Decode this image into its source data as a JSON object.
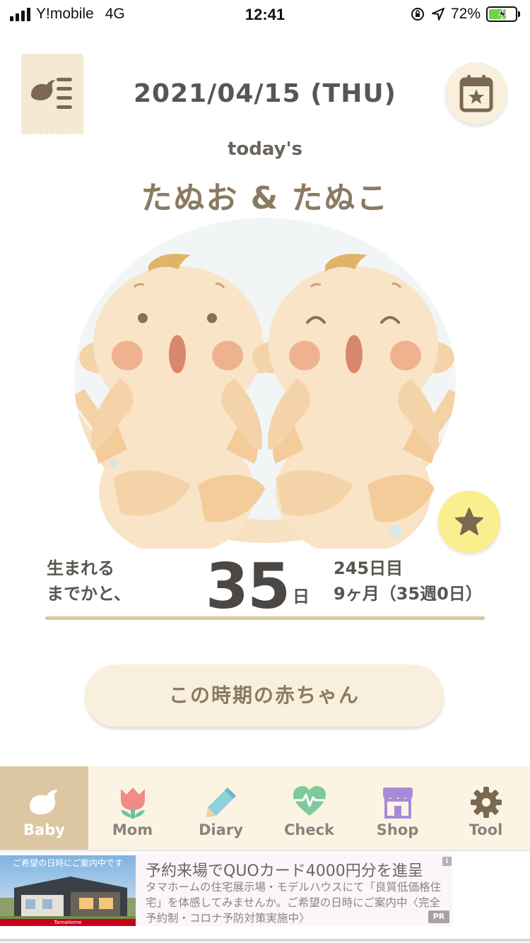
{
  "status_bar": {
    "carrier": "Y!mobile",
    "network": "4G",
    "time": "12:41",
    "battery": "72%"
  },
  "header": {
    "date": "2021/04/15 (THU)",
    "todays": "today's",
    "names": "たぬお & たぬこ"
  },
  "count": {
    "label_line1": "生まれる",
    "label_line2": "までかと、",
    "value": "35",
    "unit": "日",
    "day_number": "245日目",
    "month_week": "9ヶ月（35週0日）"
  },
  "baby_button_label": "この時期の赤ちゃん",
  "tabs": [
    {
      "label": "Baby",
      "icon": "bird-icon"
    },
    {
      "label": "Mom",
      "icon": "tulip-icon"
    },
    {
      "label": "Diary",
      "icon": "pencil-icon"
    },
    {
      "label": "Check",
      "icon": "heartbeat-icon"
    },
    {
      "label": "Shop",
      "icon": "store-icon"
    },
    {
      "label": "Tool",
      "icon": "gear-icon"
    }
  ],
  "ad": {
    "image_caption": "ご希望の日時にご案内中です",
    "logo": "TamaHome",
    "title": "予約来場でQUOカード4000円分を進呈",
    "body": "タマホームの住宅展示場・モデルハウスにて「良質低価格住宅」を体感してみませんか。ご希望の日時にご案内中〈完全予約制・コロナ予防対策実施中〉",
    "info": "i",
    "pr": "PR"
  },
  "colors": {
    "accent_beige": "#dcc7a2",
    "button_cream": "#f8f0dc",
    "star_yellow": "#f9ef8e",
    "name_brown": "#8b7a62"
  }
}
